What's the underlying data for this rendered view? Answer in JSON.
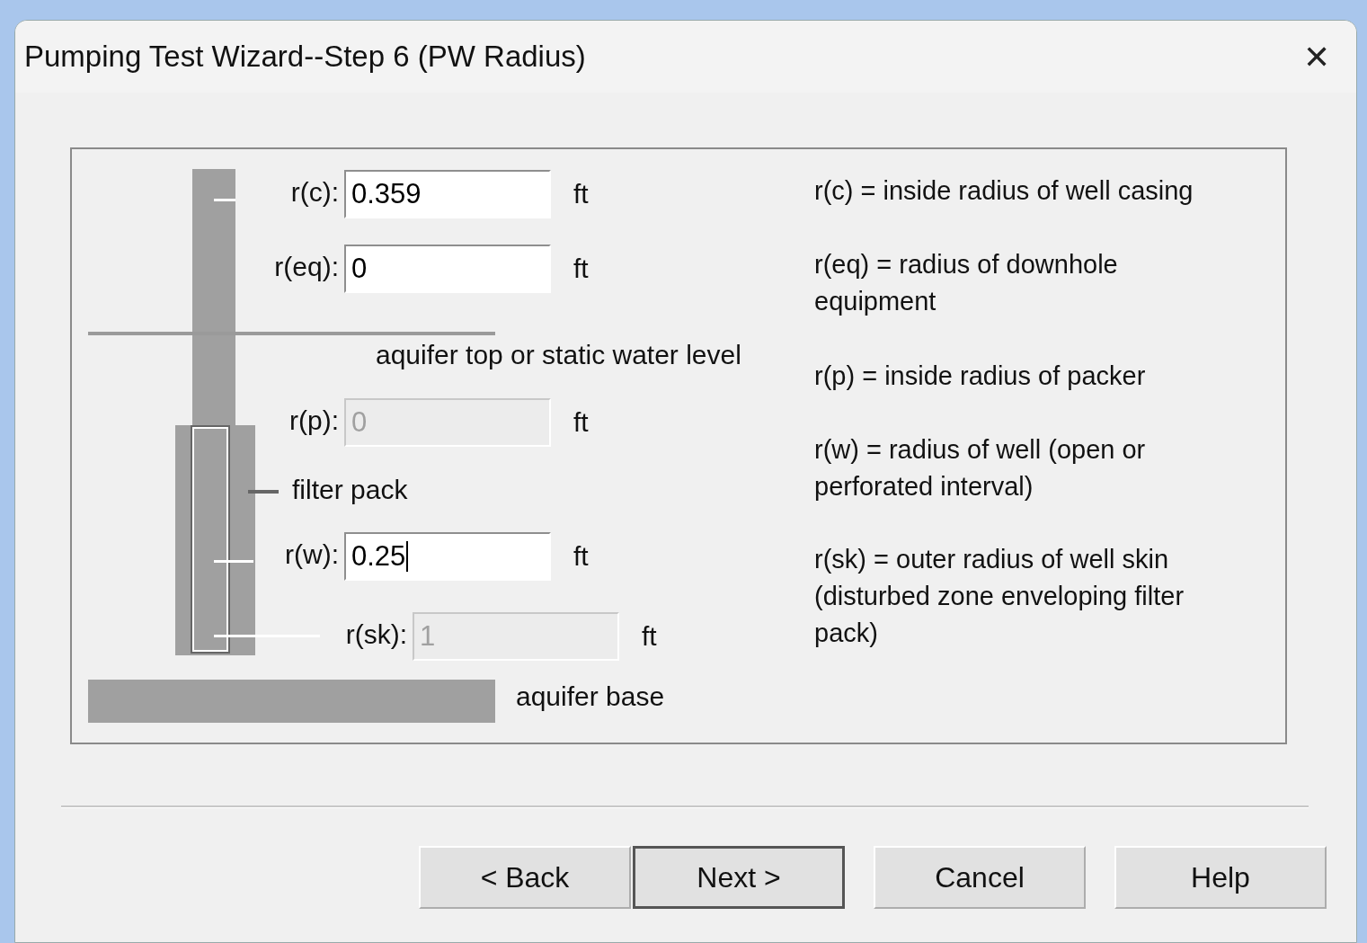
{
  "window": {
    "title": "Pumping Test Wizard--Step 6 (PW Radius)",
    "close": "✕"
  },
  "fields": [
    {
      "label": "r(c):",
      "value": "0.359",
      "unit": "ft",
      "disabled": false,
      "caret": false
    },
    {
      "label": "r(eq):",
      "value": "0",
      "unit": "ft",
      "disabled": false,
      "caret": false
    },
    {
      "label": "r(p):",
      "value": "0",
      "unit": "ft",
      "disabled": true,
      "caret": false
    },
    {
      "label": "r(w):",
      "value": "0.25",
      "unit": "ft",
      "disabled": false,
      "caret": true
    },
    {
      "label": "r(sk):",
      "value": "1",
      "unit": "ft",
      "disabled": true,
      "caret": false
    }
  ],
  "diagram_labels": {
    "aquifer_top": "aquifer top or static water level",
    "filter_pack": "filter pack",
    "aquifer_base": "aquifer base"
  },
  "descriptions": [
    "r(c) = inside radius of well casing",
    "r(eq) = radius of downhole equipment",
    "r(p) = inside radius of packer",
    "r(w) = radius of well (open or perforated interval)",
    "r(sk) = outer radius of well skin (disturbed zone enveloping filter pack)"
  ],
  "buttons": [
    {
      "label": "< Back",
      "default": false
    },
    {
      "label": "Next >",
      "default": true
    },
    {
      "label": "Cancel",
      "default": false
    },
    {
      "label": "Help",
      "default": false
    }
  ]
}
